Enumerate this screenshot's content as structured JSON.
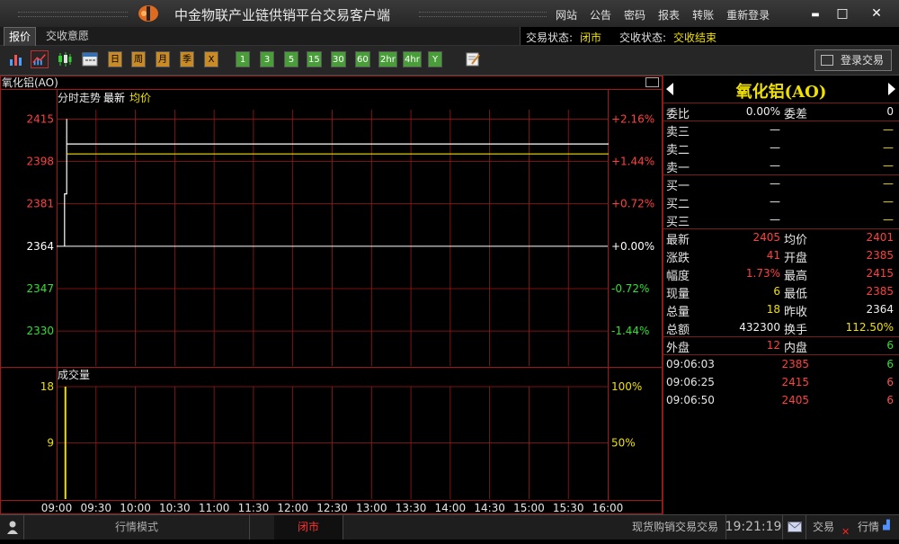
{
  "app": {
    "title": "中金物联产业链供销平台交易客户端"
  },
  "menu": [
    "网站",
    "公告",
    "密码",
    "报表",
    "转账",
    "重新登录"
  ],
  "window": {
    "minimize": "▬",
    "maximize": "□",
    "close": "✕"
  },
  "tabs": [
    "报价",
    "交收意愿"
  ],
  "status": {
    "trade_label": "交易状态:",
    "trade_value": "闭市",
    "delivery_label": "交收状态:",
    "delivery_value": "交收结束"
  },
  "toolbar": {
    "periods": [
      "日",
      "周",
      "月",
      "季",
      "Ⅹ"
    ],
    "minutes": [
      "1",
      "3",
      "5",
      "15",
      "30",
      "60",
      "2hr",
      "4hr",
      "Y"
    ],
    "login_label": "登录交易"
  },
  "chart_header": {
    "product": "氧化铝(AO)",
    "mode": "分时走势",
    "latest": "最新",
    "avg": "均价",
    "volume_title": "成交量"
  },
  "chart_data": [
    {
      "type": "line",
      "title": "分时走势",
      "x": [
        "09:00",
        "09:30",
        "10:00",
        "10:30",
        "11:00",
        "11:30",
        "12:00",
        "12:30",
        "13:00",
        "13:30",
        "14:00",
        "14:30",
        "15:00",
        "15:30",
        "16:00"
      ],
      "y_ticks": [
        "2415",
        "2398",
        "2381",
        "2364",
        "2347",
        "2330"
      ],
      "y_pct_ticks": [
        "+2.16%",
        "+1.44%",
        "+0.72%",
        "+0.00%",
        "-0.72%",
        "-1.44%"
      ],
      "ylim": [
        2316,
        2418
      ],
      "prev_close": 2364,
      "series": [
        {
          "name": "最新",
          "points": [
            [
              "09:06",
              2364
            ],
            [
              "09:06",
              2385
            ],
            [
              "09:07",
              2385
            ],
            [
              "09:07",
              2415
            ],
            [
              "09:07",
              2405
            ],
            [
              "16:00",
              2405
            ]
          ]
        },
        {
          "name": "均价",
          "points": [
            [
              "09:07",
              2401
            ],
            [
              "16:00",
              2401
            ]
          ]
        }
      ]
    },
    {
      "type": "bar",
      "title": "成交量",
      "y_ticks": [
        "18",
        "9"
      ],
      "y_pct_ticks": [
        "100%",
        "50%"
      ],
      "ylim": [
        0,
        18
      ],
      "bars": [
        [
          "09:06",
          18
        ]
      ]
    }
  ],
  "quote": {
    "name": "氧化铝(AO)",
    "weibi_label": "委比",
    "weibi": "0.00%",
    "weicha_label": "委差",
    "weicha": "0",
    "asks": [
      {
        "label": "卖三",
        "price": "—",
        "vol": "—"
      },
      {
        "label": "卖二",
        "price": "—",
        "vol": "—"
      },
      {
        "label": "卖一",
        "price": "—",
        "vol": "—"
      }
    ],
    "bids": [
      {
        "label": "买一",
        "price": "—",
        "vol": "—"
      },
      {
        "label": "买二",
        "price": "—",
        "vol": "—"
      },
      {
        "label": "买三",
        "price": "—",
        "vol": "—"
      }
    ],
    "stats": [
      [
        "最新",
        "2405",
        "均价",
        "2401"
      ],
      [
        "涨跌",
        "41",
        "开盘",
        "2385"
      ],
      [
        "幅度",
        "1.73%",
        "最高",
        "2415"
      ],
      [
        "现量",
        "6",
        "最低",
        "2385"
      ],
      [
        "总量",
        "18",
        "昨收",
        "2364"
      ],
      [
        "总额",
        "432300",
        "换手",
        "112.50%"
      ]
    ],
    "waipan_label": "外盘",
    "waipan": "12",
    "neipan_label": "内盘",
    "neipan": "6",
    "ticks": [
      [
        "09:06:03",
        "2385",
        "6"
      ],
      [
        "09:06:25",
        "2415",
        "6"
      ],
      [
        "09:06:50",
        "2405",
        "6"
      ]
    ]
  },
  "bottom": {
    "mode": "行情模式",
    "market": "闭市",
    "marquee": "现货购销交易交易",
    "time": "19:21:19",
    "trade": "交易",
    "quote": "行情"
  },
  "colors": {
    "grid": "#a01818",
    "up": "#ff4040",
    "down": "#30e030",
    "price_line": "#ffffff",
    "avg_line": "#f0e000"
  }
}
